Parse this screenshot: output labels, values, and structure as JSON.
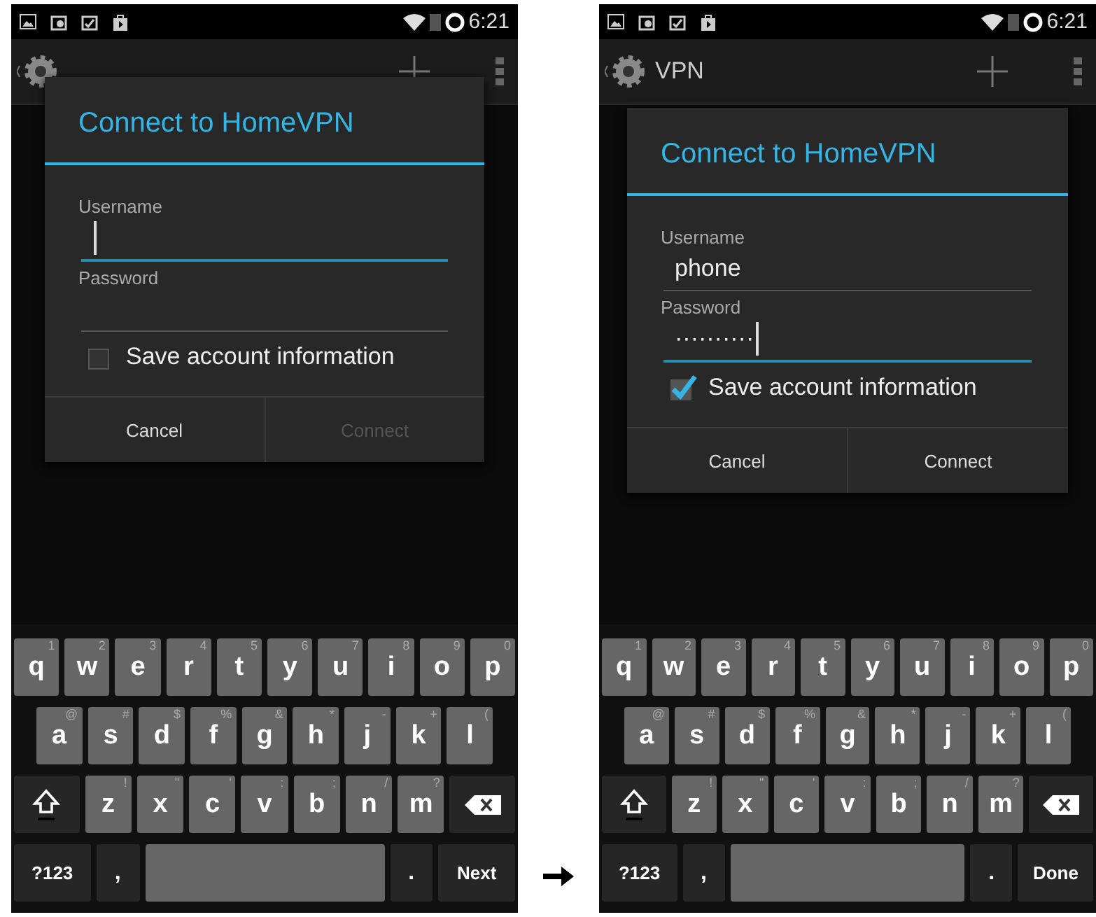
{
  "screens": [
    {
      "status_bar": {
        "time": "6:21"
      },
      "raised_dialog": true,
      "dialog": {
        "title": "Connect to HomeVPN",
        "fields": [
          {
            "label": "Username",
            "focused": true
          },
          {
            "label": "Password",
            "focused": false
          }
        ],
        "checkbox": {
          "label": "Save account information",
          "checked": false
        },
        "buttons": [
          {
            "label": "Cancel",
            "disabled": false
          },
          {
            "label": "Connect",
            "disabled": true
          }
        ]
      },
      "keyboard": {
        "rows": [
          [
            {
              "label": "q",
              "hint": "1"
            },
            {
              "label": "w",
              "hint": "2"
            },
            {
              "label": "e",
              "hint": "3"
            },
            {
              "label": "r",
              "hint": "4"
            },
            {
              "label": "t",
              "hint": "5"
            },
            {
              "label": "y",
              "hint": "6"
            },
            {
              "label": "u",
              "hint": "7"
            },
            {
              "label": "i",
              "hint": "8"
            },
            {
              "label": "o",
              "hint": "9"
            },
            {
              "label": "p",
              "hint": "0"
            }
          ],
          [
            {
              "label": "a",
              "hint": "@"
            },
            {
              "label": "s",
              "hint": "#"
            },
            {
              "label": "d",
              "hint": "$"
            },
            {
              "label": "f",
              "hint": "%"
            },
            {
              "label": "g",
              "hint": "&"
            },
            {
              "label": "h",
              "hint": "*"
            },
            {
              "label": "j",
              "hint": "-"
            },
            {
              "label": "k",
              "hint": "+"
            },
            {
              "label": "l",
              "hint": "("
            }
          ],
          [
            {
              "label": "z",
              "hint": "!"
            },
            {
              "label": "x",
              "hint": "\""
            },
            {
              "label": "c",
              "hint": "'"
            },
            {
              "label": "v",
              "hint": ":"
            },
            {
              "label": "b",
              "hint": ";"
            },
            {
              "label": "n",
              "hint": "/"
            },
            {
              "label": "m",
              "hint": "?"
            }
          ]
        ],
        "symbols_key": "?123",
        "comma_key": ",",
        "period_key": ".",
        "action_key": "Next"
      }
    },
    {
      "status_bar": {
        "time": "6:21"
      },
      "action_bar": {
        "title": "VPN"
      },
      "raised_dialog": false,
      "dialog": {
        "title": "Connect to HomeVPN",
        "fields": [
          {
            "label": "Username",
            "value": "phone",
            "focused": false
          },
          {
            "label": "Password",
            "value": "··········",
            "focused": true
          }
        ],
        "checkbox": {
          "label": "Save account information",
          "checked": true
        },
        "buttons": [
          {
            "label": "Cancel",
            "disabled": false
          },
          {
            "label": "Connect",
            "disabled": false
          }
        ]
      },
      "keyboard": {
        "rows": [
          [
            {
              "label": "q",
              "hint": "1"
            },
            {
              "label": "w",
              "hint": "2"
            },
            {
              "label": "e",
              "hint": "3"
            },
            {
              "label": "r",
              "hint": "4"
            },
            {
              "label": "t",
              "hint": "5"
            },
            {
              "label": "y",
              "hint": "6"
            },
            {
              "label": "u",
              "hint": "7"
            },
            {
              "label": "i",
              "hint": "8"
            },
            {
              "label": "o",
              "hint": "9"
            },
            {
              "label": "p",
              "hint": "0"
            }
          ],
          [
            {
              "label": "a",
              "hint": "@"
            },
            {
              "label": "s",
              "hint": "#"
            },
            {
              "label": "d",
              "hint": "$"
            },
            {
              "label": "f",
              "hint": "%"
            },
            {
              "label": "g",
              "hint": "&"
            },
            {
              "label": "h",
              "hint": "*"
            },
            {
              "label": "j",
              "hint": "-"
            },
            {
              "label": "k",
              "hint": "+"
            },
            {
              "label": "l",
              "hint": "("
            }
          ],
          [
            {
              "label": "z",
              "hint": "!"
            },
            {
              "label": "x",
              "hint": "\""
            },
            {
              "label": "c",
              "hint": "'"
            },
            {
              "label": "v",
              "hint": ":"
            },
            {
              "label": "b",
              "hint": ";"
            },
            {
              "label": "n",
              "hint": "/"
            },
            {
              "label": "m",
              "hint": "?"
            }
          ]
        ],
        "symbols_key": "?123",
        "comma_key": ",",
        "period_key": ".",
        "action_key": "Done"
      }
    }
  ]
}
